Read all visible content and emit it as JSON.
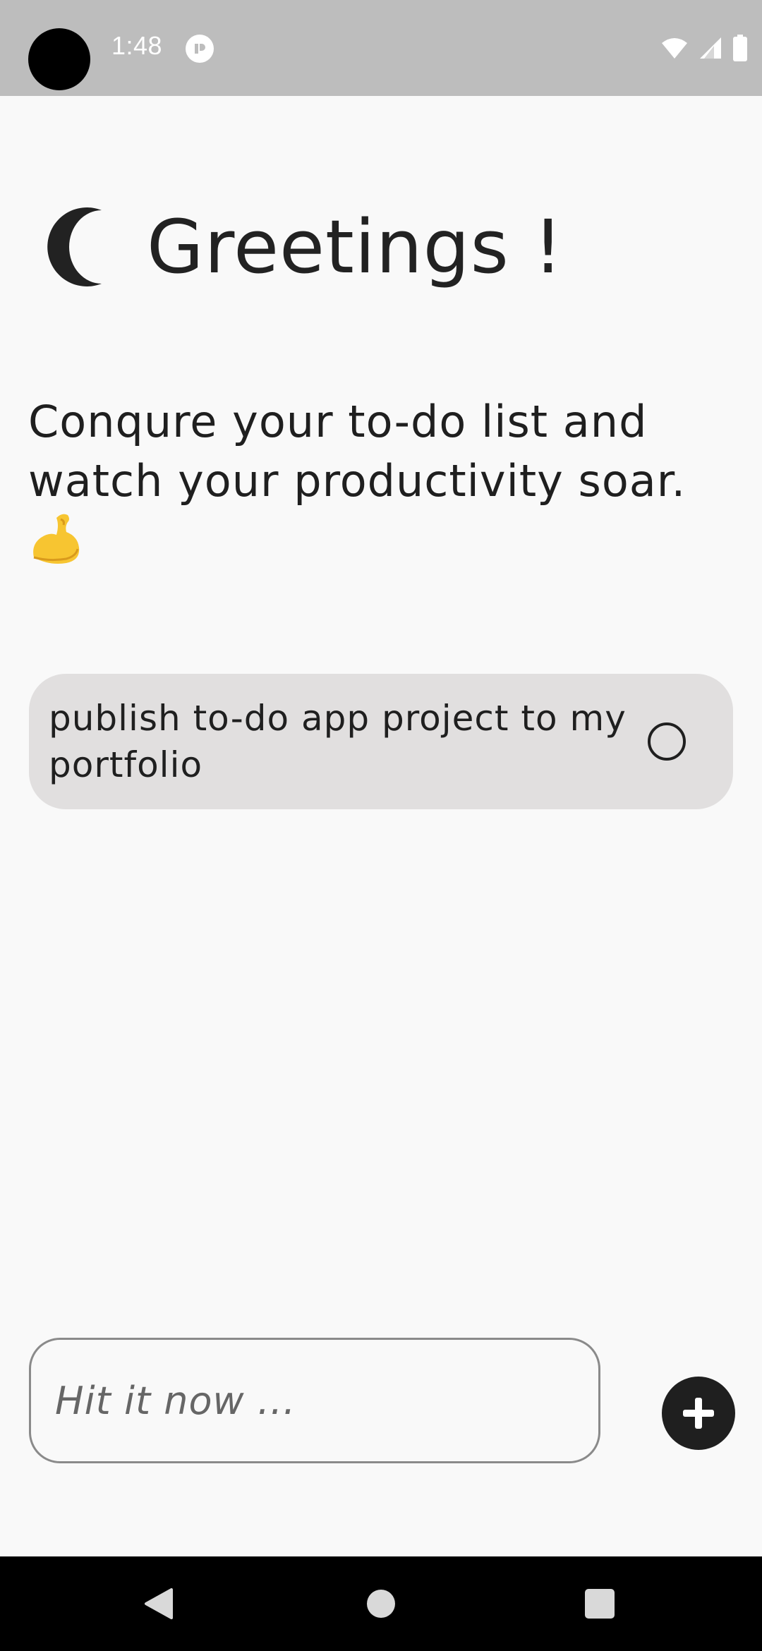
{
  "status_bar": {
    "time": "1:48"
  },
  "header": {
    "icon": "moon-icon",
    "greeting": "Greetings !"
  },
  "subtitle": {
    "text": "Conqure your to-do list and watch your productivity soar.",
    "emoji": "flexed-biceps"
  },
  "tasks": [
    {
      "text": "publish to-do app project to my portfolio",
      "done": false
    }
  ],
  "input": {
    "placeholder": "Hit it now ...",
    "value": ""
  },
  "colors": {
    "background": "#f9f9f9",
    "status_bar": "#bdbdbd",
    "task_card": "#e1dfdf",
    "accent_dark": "#1f1f1f",
    "nav_bar": "#000000"
  },
  "nav": {
    "back": "back-icon",
    "home": "home-icon",
    "recents": "recents-icon"
  }
}
